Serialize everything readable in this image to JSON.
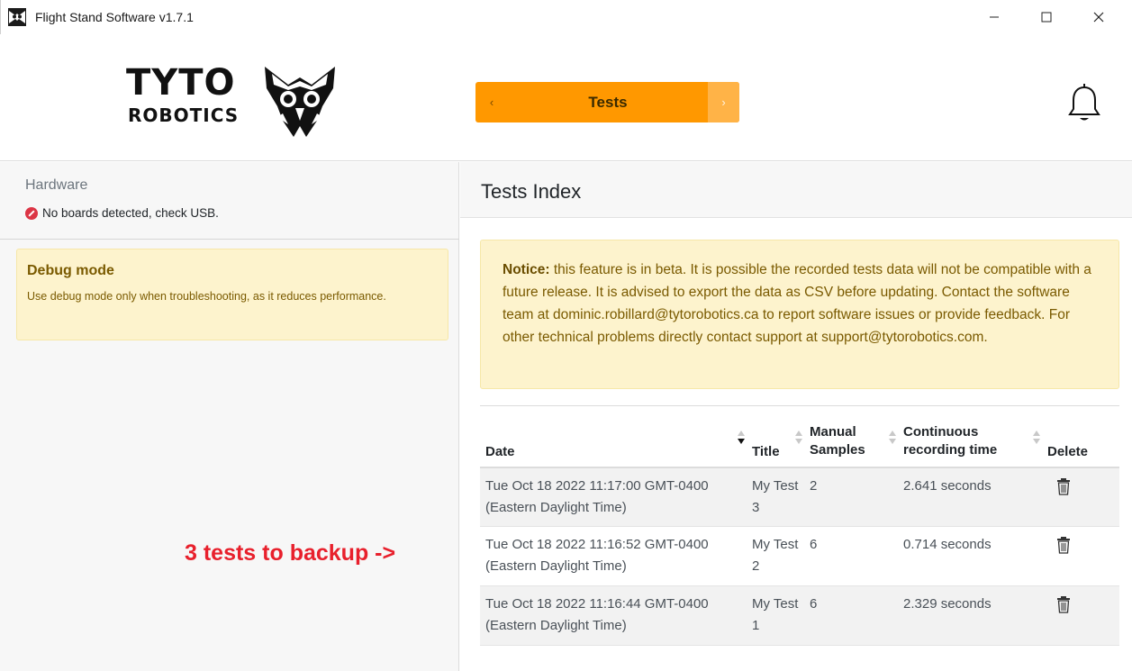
{
  "window": {
    "title": "Flight Stand Software v1.7.1",
    "minimize": "—",
    "maximize": "☐",
    "close": "✕"
  },
  "header": {
    "logo_main": "TYTO",
    "logo_sub": "ROBOTICS",
    "nav_prev": "‹",
    "nav_label": "Tests",
    "nav_next": "›"
  },
  "sidebar": {
    "hardware_title": "Hardware",
    "hardware_status": "No boards detected, check USB.",
    "debug_title": "Debug mode",
    "debug_desc": "Use debug mode only when troubleshooting, as it reduces performance.",
    "annotation": "3 tests to backup ->"
  },
  "main": {
    "title": "Tests Index",
    "notice_label": "Notice:",
    "notice_text": " this feature is in beta. It is possible the recorded tests data will not be compatible with a future release. It is advised to export the data as CSV before updating. Contact the software team at dominic.robillard@tytorobotics.ca to report software issues or provide feedback. For other technical problems directly contact support at support@tytorobotics.com."
  },
  "table": {
    "headers": {
      "date": "Date",
      "title": "Title",
      "samples": "Manual Samples",
      "recording": "Continuous recording time",
      "delete": "Delete"
    },
    "rows": [
      {
        "date": "Tue Oct 18 2022 11:17:00 GMT-0400 (Eastern Daylight Time)",
        "title": "My Test 3",
        "samples": "2",
        "recording": "2.641 seconds"
      },
      {
        "date": "Tue Oct 18 2022 11:16:52 GMT-0400 (Eastern Daylight Time)",
        "title": "My Test 2",
        "samples": "6",
        "recording": "0.714 seconds"
      },
      {
        "date": "Tue Oct 18 2022 11:16:44 GMT-0400 (Eastern Daylight Time)",
        "title": "My Test 1",
        "samples": "6",
        "recording": "2.329 seconds"
      }
    ]
  },
  "colors": {
    "accent": "#ff9800",
    "error": "#dc3545",
    "warning_bg": "#fdf3cd",
    "annotation": "#e8202c"
  },
  "icons": {
    "app": "owl-logo-icon",
    "bell": "bell-icon",
    "error": "error-circle-icon",
    "delete": "trash-icon"
  }
}
